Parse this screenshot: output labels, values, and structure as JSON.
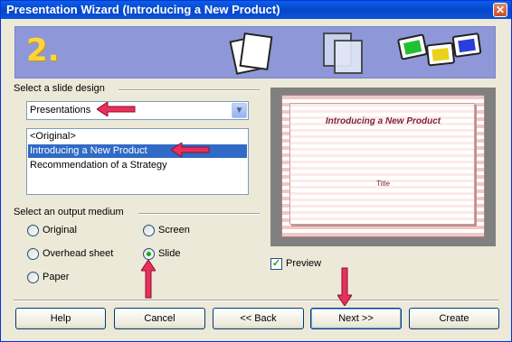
{
  "window": {
    "title": "Presentation Wizard (Introducing a New Product)",
    "close": "✕"
  },
  "banner": {
    "step": "2."
  },
  "slide_design": {
    "label": "Select a slide design",
    "category": "Presentations",
    "items": [
      "<Original>",
      "Introducing a New Product",
      "Recommendation of a Strategy"
    ],
    "selected_index": 1
  },
  "output_medium": {
    "label": "Select an output medium",
    "options": [
      "Original",
      "Screen",
      "Overhead sheet",
      "Slide",
      "Paper"
    ],
    "selected": "Slide"
  },
  "preview": {
    "slide_title": "Introducing a New Product",
    "slide_subtitle": "Title",
    "checkbox_label": "Preview",
    "checked": true
  },
  "buttons": {
    "help": "Help",
    "cancel": "Cancel",
    "back": "<< Back",
    "next": "Next >>",
    "create": "Create"
  },
  "colors": {
    "title_bar": "#0a5fea",
    "banner": "#8e98d8",
    "selection": "#316ac5",
    "annotation_arrow": "#e8305a"
  }
}
